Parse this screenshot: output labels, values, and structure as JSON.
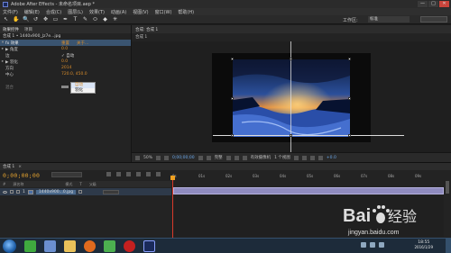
{
  "titlebar": {
    "title": "Adobe After Effects - 未命名项目.aep *",
    "minimize": "—",
    "maximize": "□",
    "close": "✕"
  },
  "menubar": {
    "items": [
      "文件(F)",
      "编辑(E)",
      "合成(C)",
      "图层(L)",
      "效果(T)",
      "动画(A)",
      "视图(V)",
      "窗口(W)",
      "帮助(H)"
    ]
  },
  "toolbar": {
    "tools": [
      "↖",
      "✋",
      "🔍",
      "↺",
      "✥",
      "▭",
      "✒",
      "T",
      "✎",
      "⬭",
      "◆",
      "✳"
    ],
    "workspace_label": "工作区:",
    "workspace_value": "标准"
  },
  "left_panel": {
    "tabs": [
      "效果控件",
      "项目"
    ],
    "layer_header": "合成 1 • 1440x900_Jz7e...jpg",
    "properties": [
      {
        "name": "fx  效果",
        "value": "重置",
        "value2": "关于..."
      },
      {
        "name": "▶ 角度",
        "value": "0.0",
        "value2": ""
      },
      {
        "name": "   边",
        "value": "✓ 自动",
        "value2": ""
      },
      {
        "name": "▶ 羽化",
        "value": "0.0",
        "value2": ""
      },
      {
        "name": "   方向",
        "value": "2014",
        "value2": ""
      },
      {
        "name": "   中心",
        "value": "720.0, 450.0",
        "value2": ""
      },
      {
        "name": "   混合",
        "value": "",
        "value2": ""
      }
    ],
    "dropdown": {
      "items": [
        "自动",
        "羽化"
      ],
      "selected": "自动"
    }
  },
  "comp_panel": {
    "tab": "合成: 合成 1",
    "breadcrumb": "合成 1",
    "footer": {
      "zoom": "50%",
      "timecode": "0;00;00;00",
      "resolution": "完整",
      "camera": "有效摄像机",
      "views": "1 个视图",
      "offset": "+0.0"
    }
  },
  "timeline": {
    "tab": "合成 1",
    "tab_close": "×",
    "timecode": "0;00;00;00",
    "columns": [
      "#",
      "源名称",
      "模式",
      "T",
      "父级"
    ],
    "ruler_ticks": [
      "0s",
      "01s",
      "02s",
      "03s",
      "04s",
      "05s",
      "06s",
      "07s",
      "08s",
      "09s"
    ],
    "layer": {
      "number": "1",
      "name": "1440x900...0.jpg",
      "parent": "无"
    }
  },
  "taskbar": {
    "time": "18:55",
    "date": "2016/1/29"
  },
  "watermark": {
    "brand": "Baidu经验",
    "url": "jingyan.baidu.com"
  },
  "colors": {
    "accent_orange": "#d88c2b",
    "playhead": "#d93a2a",
    "track_bar": "#8f8bbf",
    "selection_blue": "#3a5470"
  }
}
